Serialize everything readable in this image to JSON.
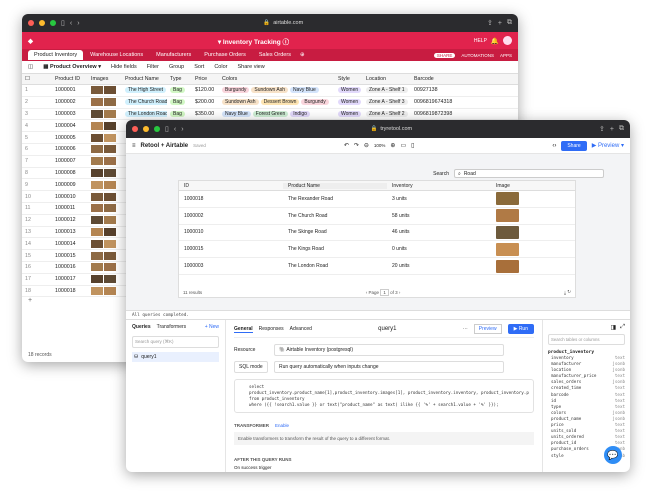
{
  "airtable": {
    "url": "airtable.com",
    "title": "Inventory Tracking",
    "help": "HELP",
    "share": "SHARE",
    "automations": "AUTOMATIONS",
    "apps": "APPS",
    "tabs": [
      "Product Inventory",
      "Warehouse Locations",
      "Manufacturers",
      "Purchase Orders",
      "Sales Orders"
    ],
    "view_name": "Product Overview",
    "toolbar": [
      "Hide fields",
      "Filter",
      "Group",
      "Sort",
      "Color",
      "Share view"
    ],
    "columns": [
      "Product ID",
      "Images",
      "Type",
      "Product Name",
      "Price",
      "Colors",
      "Style",
      "Location",
      "Barcode"
    ],
    "rows": [
      {
        "n": "1",
        "id": "1000001",
        "type": "Bag",
        "name": "The High Street",
        "price": "$120.00",
        "colors": [
          "Burgundy",
          "Sundown Ash",
          "Navy Blue"
        ],
        "style": "Women",
        "loc": "Zone A - Shelf 1",
        "bar": "00927138"
      },
      {
        "n": "2",
        "id": "1000002",
        "type": "Bag",
        "name": "The Church Road",
        "price": "$200.00",
        "colors": [
          "Sundown Ash",
          "Dessert Brown",
          "Burgundy"
        ],
        "style": "Women",
        "loc": "Zone A - Shelf 3",
        "bar": "0096819674318"
      },
      {
        "n": "3",
        "id": "1000003",
        "type": "Bag",
        "name": "The London Road",
        "price": "$350.00",
        "colors": [
          "Navy Blue",
          "Forest Green",
          "Indigo"
        ],
        "style": "Women",
        "loc": "Zone A - Shelf 2",
        "bar": "0096819872398"
      },
      {
        "n": "4",
        "id": "1000004"
      },
      {
        "n": "5",
        "id": "1000005"
      },
      {
        "n": "6",
        "id": "1000006"
      },
      {
        "n": "7",
        "id": "1000007"
      },
      {
        "n": "8",
        "id": "1000008"
      },
      {
        "n": "9",
        "id": "1000009"
      },
      {
        "n": "10",
        "id": "1000010"
      },
      {
        "n": "11",
        "id": "1000011"
      },
      {
        "n": "12",
        "id": "1000012"
      },
      {
        "n": "13",
        "id": "1000013"
      },
      {
        "n": "14",
        "id": "1000014"
      },
      {
        "n": "15",
        "id": "1000015"
      },
      {
        "n": "16",
        "id": "1000016"
      },
      {
        "n": "17",
        "id": "1000017"
      },
      {
        "n": "18",
        "id": "1000018"
      }
    ],
    "footer": "18 records"
  },
  "retool": {
    "url": "tryretool.com",
    "app": "Retool + Airtable",
    "saved": "Saved",
    "zoom": "100%",
    "share": "Share",
    "preview": "Preview",
    "search_label": "Search",
    "search_value": "Road",
    "table_cols": [
      "ID",
      "Product Name",
      "Inventory",
      "Image"
    ],
    "table_rows": [
      {
        "id": "1000018",
        "name": "The Rexander Road",
        "inv": "3 units",
        "c": "#8a6a3a"
      },
      {
        "id": "1000002",
        "name": "The Church Road",
        "inv": "58 units",
        "c": "#b07a45"
      },
      {
        "id": "1000010",
        "name": "The Skinge Road",
        "inv": "46 units",
        "c": "#6d5a3c"
      },
      {
        "id": "1000015",
        "name": "The Kings Road",
        "inv": "0 units",
        "c": "#c88f52"
      },
      {
        "id": "1000003",
        "name": "The London Road",
        "inv": "20 units",
        "c": "#a86f3a"
      }
    ],
    "results": "11 results",
    "page": "Page",
    "page_num": "1",
    "page_total": "of 3",
    "status": "All queries completed.",
    "left": {
      "tabs": [
        "Queries",
        "Transformers"
      ],
      "new": "+ New",
      "search_ph": "Search query (⌘K)",
      "query": "query1"
    },
    "mid": {
      "tabs": [
        "General",
        "Responses",
        "Advanced"
      ],
      "query_name": "query1",
      "preview": "Preview",
      "run": "▶ Run",
      "resource_label": "Resource",
      "resource": "Airtable Inventory (postgresql)",
      "mode": "SQL mode",
      "run_mode": "Run query automatically when inputs change",
      "code": [
        "select",
        "  product_inventory.product_name[1],product_inventory.images[1], product_inventory.inventory, product_inventory.product_id",
        "from product_inventory",
        "where ({{ !search1.value }} or text(\"product_name\" as text) ilike {{ '%' + search1.value + '%' }});"
      ],
      "transformer_label": "TRANSFORMER",
      "enable": "Enable",
      "transformer_desc": "Enable transformers to transform the result of the query to a different format.",
      "after_label": "AFTER THIS QUERY RUNS",
      "after_sub": "On success trigger"
    },
    "right": {
      "search_ph": "Search tables or columns",
      "table": "product_inventory",
      "fields": [
        [
          "inventory",
          "text"
        ],
        [
          "manufacturer",
          "jsonb"
        ],
        [
          "location",
          "jsonb"
        ],
        [
          "manufacturer_price",
          "text"
        ],
        [
          "sales_orders",
          "jsonb"
        ],
        [
          "created_time",
          "text"
        ],
        [
          "barcode",
          "text"
        ],
        [
          "id",
          "text"
        ],
        [
          "type",
          "text"
        ],
        [
          "colors",
          "jsonb"
        ],
        [
          "product_name",
          "jsonb"
        ],
        [
          "price",
          "text"
        ],
        [
          "units_sold",
          "text"
        ],
        [
          "units_ordered",
          "text"
        ],
        [
          "product_id",
          "text"
        ],
        [
          "purchase_orders",
          "jsonb"
        ],
        [
          "style",
          "jsonb"
        ]
      ]
    }
  }
}
